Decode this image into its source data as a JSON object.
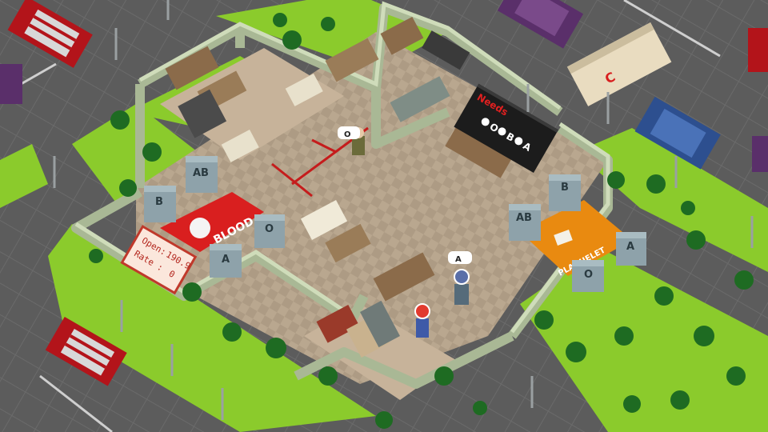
{
  "board": {
    "title": "Needs",
    "items": [
      "O",
      "B",
      "A"
    ]
  },
  "blood_room": {
    "label": "BLOOD",
    "fridges": [
      "AB",
      "B",
      "A",
      "O"
    ]
  },
  "plasma_room": {
    "label": "PLAQUELET",
    "fridges": [
      "AB",
      "B",
      "A",
      "O"
    ]
  },
  "sign": {
    "open_label": "Open:",
    "open_value": "190.9",
    "rate_label": "Rate :",
    "rate_value": "0"
  },
  "bubbles": {
    "visitor_left": "O",
    "visitor_right": "A"
  },
  "ambulance_letter": "C",
  "colors": {
    "grass": "#8fcf2c",
    "floor": "#b7a58e",
    "wall": "#bcc9a8",
    "blood_red": "#d91f1f",
    "plasma_orange": "#e98a10",
    "fridge": "#8aa0a8",
    "road": "#5d5d5d"
  }
}
